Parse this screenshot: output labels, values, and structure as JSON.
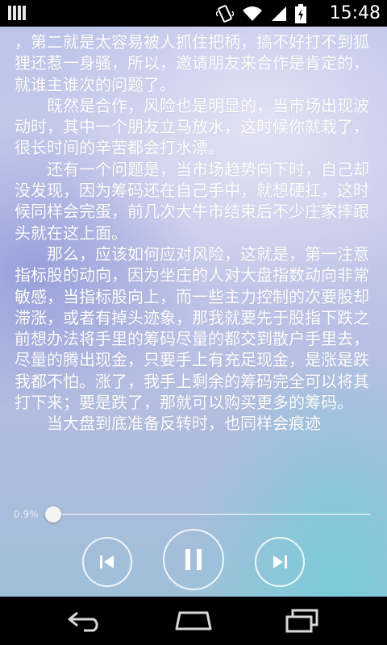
{
  "status_bar": {
    "time": "15:48",
    "icons": [
      "signal-bars-icon",
      "vibrate-icon",
      "wifi-icon",
      "cell-signal-icon",
      "battery-icon"
    ]
  },
  "reader": {
    "paragraphs": [
      {
        "indent": false,
        "text": "，第二就是太容易被人抓住把柄，搞不好打不到狐狸还惹一身骚，所以，邀请朋友来合作是肯定的，就谁主谁次的问题了。"
      },
      {
        "indent": true,
        "text": "既然是合作，风险也是明显的，当市场出现波动时，其中一个朋友立马放水，这时候你就栽了，很长时间的辛苦都会打水漂。"
      },
      {
        "indent": true,
        "text": "还有一个问题是，当市场趋势向下时，自己却没发现，因为筹码还在自己手中，就想硬扛，这时候同样会完蛋，前几次大牛市结束后不少庄家摔跟头就在这上面。"
      },
      {
        "indent": true,
        "text": "那么，应该如何应对风险，这就是，第一注意指标股的动向，因为坐庄的人对大盘指数动向非常敏感，当指标股向上，而一些主力控制的次要股却滞涨，或者有掉头迹象，那我就要先于股指下跌之前想办法将手里的筹码尽量的都交到散户手里去，尽量的腾出现金，只要手上有充足现金，是涨是跌我都不怕。涨了，我手上剩余的筹码完全可以将其打下来；要是跌了，那就可以购买更多的筹码。"
      },
      {
        "indent": true,
        "text": "当大盘到底准备反转时，也同样会痕迹"
      }
    ]
  },
  "player": {
    "progress_label": "0.9%",
    "progress_fraction": 0.009,
    "prev_icon": "skip-previous-icon",
    "play_icon": "pause-icon",
    "next_icon": "skip-next-icon"
  },
  "nav_bar": {
    "icons": [
      "back-icon",
      "home-icon",
      "recent-apps-icon"
    ]
  },
  "colors": {
    "text": "#ffffff",
    "status_bg": "#000000",
    "accent_teal": "#78cdd7"
  }
}
